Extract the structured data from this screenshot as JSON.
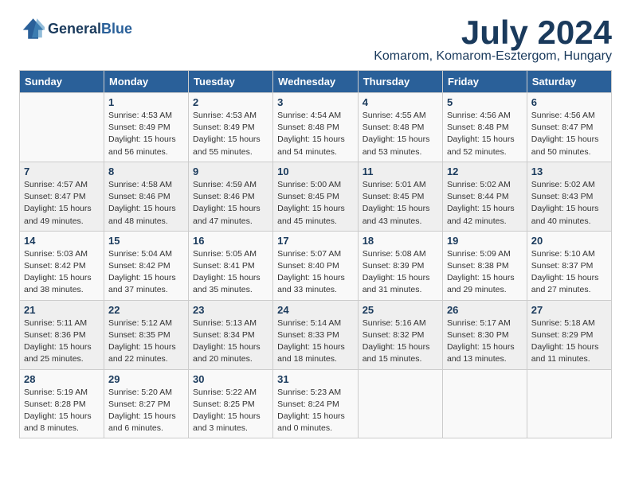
{
  "header": {
    "logo_line1": "General",
    "logo_line2": "Blue",
    "month": "July 2024",
    "location": "Komarom, Komarom-Esztergom, Hungary"
  },
  "weekdays": [
    "Sunday",
    "Monday",
    "Tuesday",
    "Wednesday",
    "Thursday",
    "Friday",
    "Saturday"
  ],
  "weeks": [
    [
      {
        "day": "",
        "info": ""
      },
      {
        "day": "1",
        "info": "Sunrise: 4:53 AM\nSunset: 8:49 PM\nDaylight: 15 hours\nand 56 minutes."
      },
      {
        "day": "2",
        "info": "Sunrise: 4:53 AM\nSunset: 8:49 PM\nDaylight: 15 hours\nand 55 minutes."
      },
      {
        "day": "3",
        "info": "Sunrise: 4:54 AM\nSunset: 8:48 PM\nDaylight: 15 hours\nand 54 minutes."
      },
      {
        "day": "4",
        "info": "Sunrise: 4:55 AM\nSunset: 8:48 PM\nDaylight: 15 hours\nand 53 minutes."
      },
      {
        "day": "5",
        "info": "Sunrise: 4:56 AM\nSunset: 8:48 PM\nDaylight: 15 hours\nand 52 minutes."
      },
      {
        "day": "6",
        "info": "Sunrise: 4:56 AM\nSunset: 8:47 PM\nDaylight: 15 hours\nand 50 minutes."
      }
    ],
    [
      {
        "day": "7",
        "info": "Sunrise: 4:57 AM\nSunset: 8:47 PM\nDaylight: 15 hours\nand 49 minutes."
      },
      {
        "day": "8",
        "info": "Sunrise: 4:58 AM\nSunset: 8:46 PM\nDaylight: 15 hours\nand 48 minutes."
      },
      {
        "day": "9",
        "info": "Sunrise: 4:59 AM\nSunset: 8:46 PM\nDaylight: 15 hours\nand 47 minutes."
      },
      {
        "day": "10",
        "info": "Sunrise: 5:00 AM\nSunset: 8:45 PM\nDaylight: 15 hours\nand 45 minutes."
      },
      {
        "day": "11",
        "info": "Sunrise: 5:01 AM\nSunset: 8:45 PM\nDaylight: 15 hours\nand 43 minutes."
      },
      {
        "day": "12",
        "info": "Sunrise: 5:02 AM\nSunset: 8:44 PM\nDaylight: 15 hours\nand 42 minutes."
      },
      {
        "day": "13",
        "info": "Sunrise: 5:02 AM\nSunset: 8:43 PM\nDaylight: 15 hours\nand 40 minutes."
      }
    ],
    [
      {
        "day": "14",
        "info": "Sunrise: 5:03 AM\nSunset: 8:42 PM\nDaylight: 15 hours\nand 38 minutes."
      },
      {
        "day": "15",
        "info": "Sunrise: 5:04 AM\nSunset: 8:42 PM\nDaylight: 15 hours\nand 37 minutes."
      },
      {
        "day": "16",
        "info": "Sunrise: 5:05 AM\nSunset: 8:41 PM\nDaylight: 15 hours\nand 35 minutes."
      },
      {
        "day": "17",
        "info": "Sunrise: 5:07 AM\nSunset: 8:40 PM\nDaylight: 15 hours\nand 33 minutes."
      },
      {
        "day": "18",
        "info": "Sunrise: 5:08 AM\nSunset: 8:39 PM\nDaylight: 15 hours\nand 31 minutes."
      },
      {
        "day": "19",
        "info": "Sunrise: 5:09 AM\nSunset: 8:38 PM\nDaylight: 15 hours\nand 29 minutes."
      },
      {
        "day": "20",
        "info": "Sunrise: 5:10 AM\nSunset: 8:37 PM\nDaylight: 15 hours\nand 27 minutes."
      }
    ],
    [
      {
        "day": "21",
        "info": "Sunrise: 5:11 AM\nSunset: 8:36 PM\nDaylight: 15 hours\nand 25 minutes."
      },
      {
        "day": "22",
        "info": "Sunrise: 5:12 AM\nSunset: 8:35 PM\nDaylight: 15 hours\nand 22 minutes."
      },
      {
        "day": "23",
        "info": "Sunrise: 5:13 AM\nSunset: 8:34 PM\nDaylight: 15 hours\nand 20 minutes."
      },
      {
        "day": "24",
        "info": "Sunrise: 5:14 AM\nSunset: 8:33 PM\nDaylight: 15 hours\nand 18 minutes."
      },
      {
        "day": "25",
        "info": "Sunrise: 5:16 AM\nSunset: 8:32 PM\nDaylight: 15 hours\nand 15 minutes."
      },
      {
        "day": "26",
        "info": "Sunrise: 5:17 AM\nSunset: 8:30 PM\nDaylight: 15 hours\nand 13 minutes."
      },
      {
        "day": "27",
        "info": "Sunrise: 5:18 AM\nSunset: 8:29 PM\nDaylight: 15 hours\nand 11 minutes."
      }
    ],
    [
      {
        "day": "28",
        "info": "Sunrise: 5:19 AM\nSunset: 8:28 PM\nDaylight: 15 hours\nand 8 minutes."
      },
      {
        "day": "29",
        "info": "Sunrise: 5:20 AM\nSunset: 8:27 PM\nDaylight: 15 hours\nand 6 minutes."
      },
      {
        "day": "30",
        "info": "Sunrise: 5:22 AM\nSunset: 8:25 PM\nDaylight: 15 hours\nand 3 minutes."
      },
      {
        "day": "31",
        "info": "Sunrise: 5:23 AM\nSunset: 8:24 PM\nDaylight: 15 hours\nand 0 minutes."
      },
      {
        "day": "",
        "info": ""
      },
      {
        "day": "",
        "info": ""
      },
      {
        "day": "",
        "info": ""
      }
    ]
  ]
}
